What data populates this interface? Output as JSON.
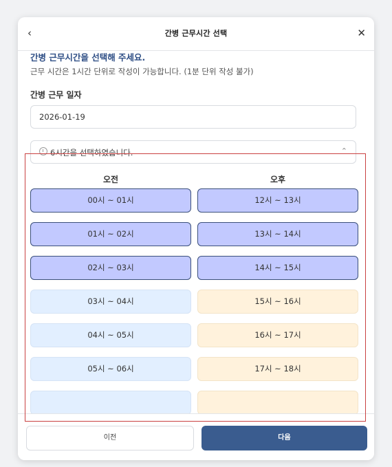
{
  "header": {
    "back_icon": "chevron-left-icon",
    "title": "간병 근무시간 선택",
    "close_icon": "close-icon"
  },
  "intro": {
    "heading": "간병 근무시간을 선택해 주세요.",
    "subtext": "근무 시간은 1시간 단위로 작성이 가능합니다. (1분 단위 작성 불가)"
  },
  "date": {
    "label": "간병 근무 일자",
    "value": "2026-01-19"
  },
  "summary": {
    "text": "6시간을 선택하였습니다.",
    "icon": "clock-icon",
    "toggle_icon": "chevron-up-icon"
  },
  "columns": {
    "am": "오전",
    "pm": "오후"
  },
  "slots": {
    "am": [
      {
        "label": "00시 ~ 01시",
        "selected": true
      },
      {
        "label": "01시 ~ 02시",
        "selected": true
      },
      {
        "label": "02시 ~ 03시",
        "selected": true
      },
      {
        "label": "03시 ~ 04시",
        "selected": false
      },
      {
        "label": "04시 ~ 05시",
        "selected": false
      },
      {
        "label": "05시 ~ 06시",
        "selected": false
      }
    ],
    "pm": [
      {
        "label": "12시 ~ 13시",
        "selected": true
      },
      {
        "label": "13시 ~ 14시",
        "selected": true
      },
      {
        "label": "14시 ~ 15시",
        "selected": true
      },
      {
        "label": "15시 ~ 16시",
        "selected": false
      },
      {
        "label": "16시 ~ 17시",
        "selected": false
      },
      {
        "label": "17시 ~ 18시",
        "selected": false
      }
    ]
  },
  "footer": {
    "prev_label": "이전",
    "next_label": "다음"
  },
  "colors": {
    "selected": "#c2c9ff",
    "am": "#e2efff",
    "pm": "#fff2dc",
    "primary": "#3a5c8f",
    "highlight_border": "#c94040"
  }
}
